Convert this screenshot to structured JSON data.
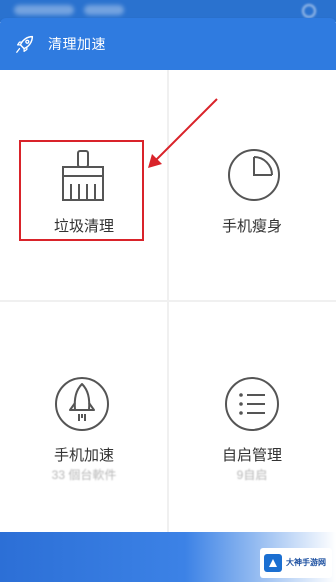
{
  "header": {
    "title": "清理加速",
    "icon": "rocket-icon",
    "background": "#2f7be0"
  },
  "tiles": [
    {
      "label": "垃圾清理",
      "icon": "broom-icon",
      "sub": ""
    },
    {
      "label": "手机瘦身",
      "icon": "pie-chart-icon",
      "sub": ""
    },
    {
      "label": "手机加速",
      "icon": "rocket-icon",
      "sub": "33 個台軟件"
    },
    {
      "label": "自启管理",
      "icon": "list-icon",
      "sub": "9自启"
    }
  ],
  "annotation": {
    "highlight_color": "#d9232a",
    "target": "垃圾清理"
  },
  "watermark": {
    "text": "大神手游网"
  }
}
